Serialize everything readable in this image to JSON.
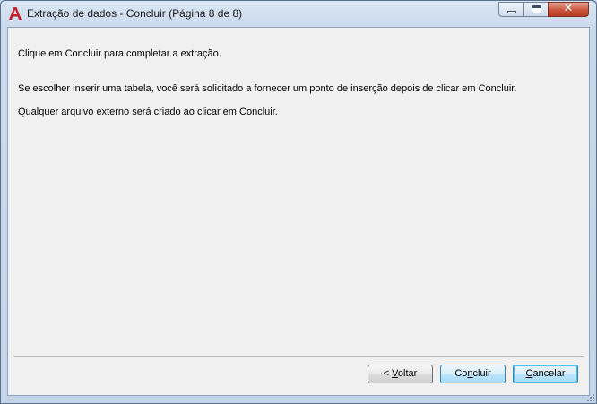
{
  "window": {
    "title": "Extração de dados - Concluir (Página 8 de 8)",
    "app_icon": "autocad-a-icon",
    "controls": {
      "minimize": "minimize-icon",
      "maximize": "maximize-icon",
      "close": "close-icon",
      "close_glyph": "✕"
    }
  },
  "body": {
    "line1": "Clique em Concluir para completar a extração.",
    "line2": "Se escolher inserir uma tabela, você será solicitado a fornecer um ponto de inserção depois de clicar em Concluir.",
    "line3": "Qualquer arquivo externo será criado ao clicar em Concluir."
  },
  "buttons": {
    "back": {
      "prefix": "< ",
      "accel": "V",
      "rest": "oltar"
    },
    "finish": {
      "prefix": "Co",
      "accel": "n",
      "rest": "cluir"
    },
    "cancel": {
      "prefix": "",
      "accel": "C",
      "rest": "ancelar"
    }
  },
  "colors": {
    "title_bar": "#c9d9ec",
    "content_bg": "#f0f0f0",
    "close_button": "#c8543b",
    "app_icon_red": "#c62026",
    "default_button_border": "#3c7fb1"
  }
}
